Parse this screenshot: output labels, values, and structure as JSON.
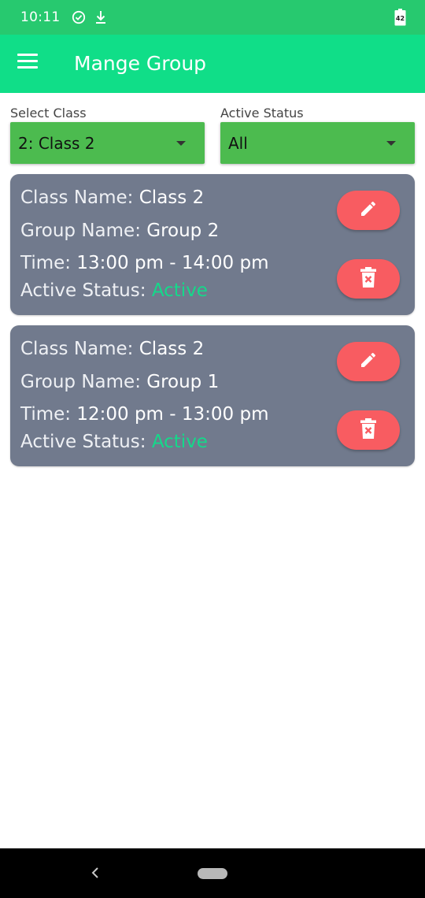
{
  "status_bar": {
    "time": "10:11",
    "battery_level": "42"
  },
  "app_bar": {
    "title": "Mange Group"
  },
  "filters": {
    "class": {
      "label": "Select Class",
      "value": "2: Class 2"
    },
    "status": {
      "label": "Active Status",
      "value": "All"
    }
  },
  "groups": [
    {
      "class_label": "Class Name:",
      "class_value": "Class 2",
      "group_label": "Group Name:",
      "group_value": "Group 2",
      "time_label": "Time:",
      "time_value": "13:00 pm - 14:00 pm",
      "status_label": "Active Status:",
      "status_value": "Active"
    },
    {
      "class_label": "Class Name:",
      "class_value": "Class 2",
      "group_label": "Group Name:",
      "group_value": "Group 1",
      "time_label": "Time:",
      "time_value": "12:00 pm - 13:00 pm",
      "status_label": "Active Status:",
      "status_value": "Active"
    }
  ],
  "icons": {
    "menu": "hamburger-icon",
    "edit": "pencil-icon",
    "delete": "trash-x-icon",
    "check": "check-circle-icon",
    "download": "download-icon"
  },
  "colors": {
    "status_bar": "#27c96f",
    "app_bar": "#10de88",
    "select_bg": "#4cbb4f",
    "card_bg": "#717a8d",
    "active_text": "#14d98a",
    "action_button": "#f85c61"
  }
}
